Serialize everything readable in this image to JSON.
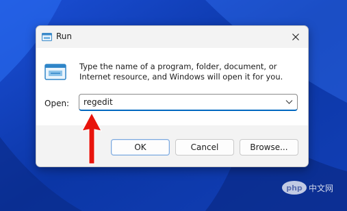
{
  "dialog": {
    "title": "Run",
    "description": "Type the name of a program, folder, document, or Internet resource, and Windows will open it for you.",
    "open_label": "Open:",
    "open_value": "regedit",
    "buttons": {
      "ok": "OK",
      "cancel": "Cancel",
      "browse": "Browse..."
    }
  },
  "annotation": {
    "arrow_color": "#e8140c"
  },
  "watermark": {
    "text": "php 中文网"
  },
  "colors": {
    "wallpaper": "#0a3fb8",
    "accent": "#0067c0"
  }
}
